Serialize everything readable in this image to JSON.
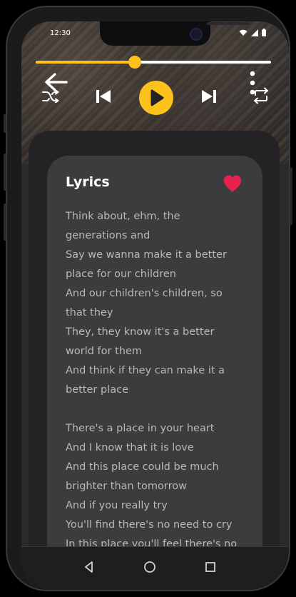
{
  "status_bar": {
    "time": "12:30"
  },
  "player": {
    "progress": 0.42
  },
  "lyrics": {
    "title": "Lyrics",
    "favorited": true,
    "lines": [
      "Think about, ehm, the",
      "generations and",
      "Say we wanna make it a better",
      "place for our children",
      "And our children's children, so",
      "that they",
      "They, they know it's a better",
      "world for them",
      "And think if they can make it a",
      "better place",
      "",
      "There's a place in your heart",
      "And I know that it is love",
      "And this place could be much",
      "brighter than tomorrow",
      "And if you really try",
      "You'll find there's no need to cry",
      "In this place you'll feel there's no"
    ]
  },
  "colors": {
    "accent": "#fcc21b",
    "heart": "#e8214f",
    "card": "#3c3c3e",
    "background": "#232325"
  },
  "icons": {
    "back": "arrow-left-icon",
    "menu": "more-vertical-icon",
    "shuffle": "shuffle-icon",
    "previous": "skip-previous-icon",
    "play": "play-icon",
    "next": "skip-next-icon",
    "repeat": "repeat-icon",
    "favorite": "heart-icon",
    "nav_back": "triangle-back-icon",
    "nav_home": "circle-home-icon",
    "nav_recents": "square-recents-icon"
  }
}
